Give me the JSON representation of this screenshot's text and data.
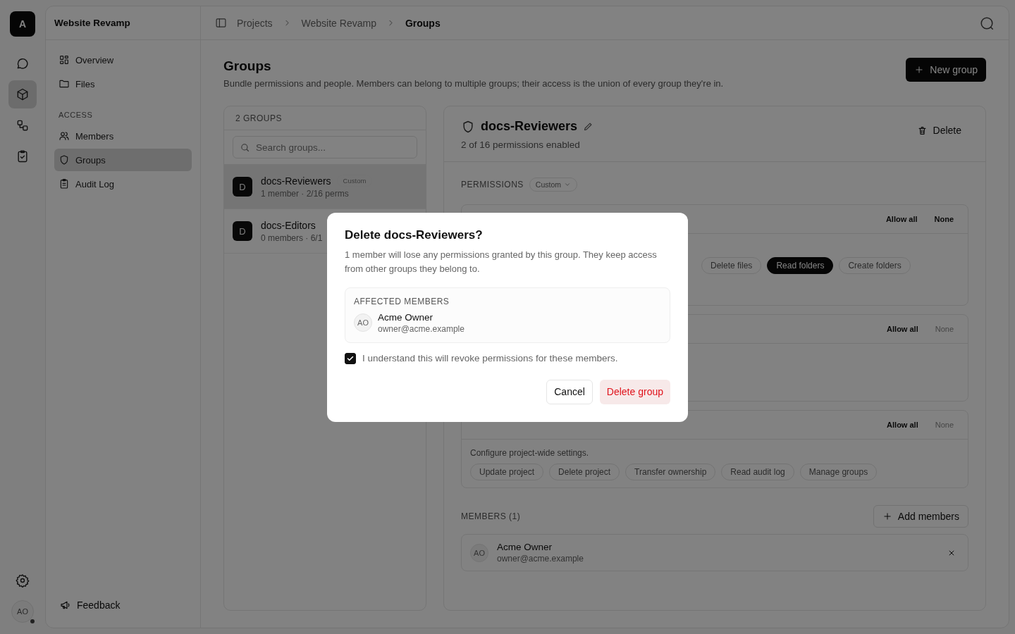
{
  "rail": {
    "logo": "A",
    "items": [
      {
        "kind": "chat",
        "selected": false
      },
      {
        "kind": "cube",
        "selected": true
      },
      {
        "kind": "flow",
        "selected": false
      },
      {
        "kind": "clipboard",
        "selected": false
      }
    ],
    "avatar": "AO"
  },
  "nav": {
    "title": "Website Revamp",
    "items": [
      {
        "label": "Overview",
        "selected": false
      },
      {
        "label": "Files",
        "selected": false
      }
    ],
    "section_label": "ACCESS",
    "access_items": [
      {
        "label": "Members",
        "selected": false
      },
      {
        "label": "Groups",
        "selected": true
      },
      {
        "label": "Audit Log",
        "selected": false
      }
    ],
    "feedback": "Feedback"
  },
  "breadcrumb": [
    {
      "label": "Projects",
      "current": false
    },
    {
      "label": "Website Revamp",
      "current": false
    },
    {
      "label": "Groups",
      "current": true
    }
  ],
  "page": {
    "title": "Groups",
    "description": "Bundle permissions and people. Members can belong to multiple groups; their access is the union of every group they're in.",
    "new_button": "New group"
  },
  "groups_panel": {
    "count_label": "2 GROUPS",
    "search_placeholder": "Search groups...",
    "groups": [
      {
        "initial": "D",
        "name": "docs-Reviewers",
        "badge": "Custom",
        "meta": "1 member · 2/16 perms",
        "selected": true
      },
      {
        "initial": "D",
        "name": "docs-Editors",
        "meta": "0 members · 6/1",
        "selected": false
      }
    ]
  },
  "detail": {
    "name": "docs-Reviewers",
    "summary": "2 of 16 permissions enabled",
    "delete_label": "Delete",
    "permissions_label": "PERMISSIONS",
    "preset": "Custom",
    "sections": [
      {
        "allow_all": "Allow all",
        "none": "None",
        "none_disabled": false,
        "chips": [
          {
            "label": "Delete files",
            "selected": false
          },
          {
            "label": "Read folders",
            "selected": true
          },
          {
            "label": "Create folders",
            "selected": false
          }
        ]
      },
      {
        "allow_all": "Allow all",
        "none": "None",
        "none_disabled": true
      },
      {
        "allow_all": "Allow all",
        "none": "None",
        "none_disabled": true,
        "description": "Configure project-wide settings.",
        "chips": [
          {
            "label": "Update project",
            "selected": false
          },
          {
            "label": "Delete project",
            "selected": false
          },
          {
            "label": "Transfer ownership",
            "selected": false
          },
          {
            "label": "Read audit log",
            "selected": false
          },
          {
            "label": "Manage groups",
            "selected": false
          }
        ]
      }
    ],
    "members_label": "MEMBERS (1)",
    "add_members": "Add members",
    "members": [
      {
        "initials": "AO",
        "name": "Acme Owner",
        "email": "owner@acme.example"
      }
    ]
  },
  "dialog": {
    "title": "Delete docs-Reviewers?",
    "body": "1 member will lose any permissions granted by this group. They keep access from other groups they belong to.",
    "affected_label": "AFFECTED MEMBERS",
    "members": [
      {
        "initials": "AO",
        "name": "Acme Owner",
        "email": "owner@acme.example"
      }
    ],
    "confirm_text": "I understand this will revoke permissions for these members.",
    "checked": true,
    "cancel": "Cancel",
    "delete": "Delete group"
  }
}
